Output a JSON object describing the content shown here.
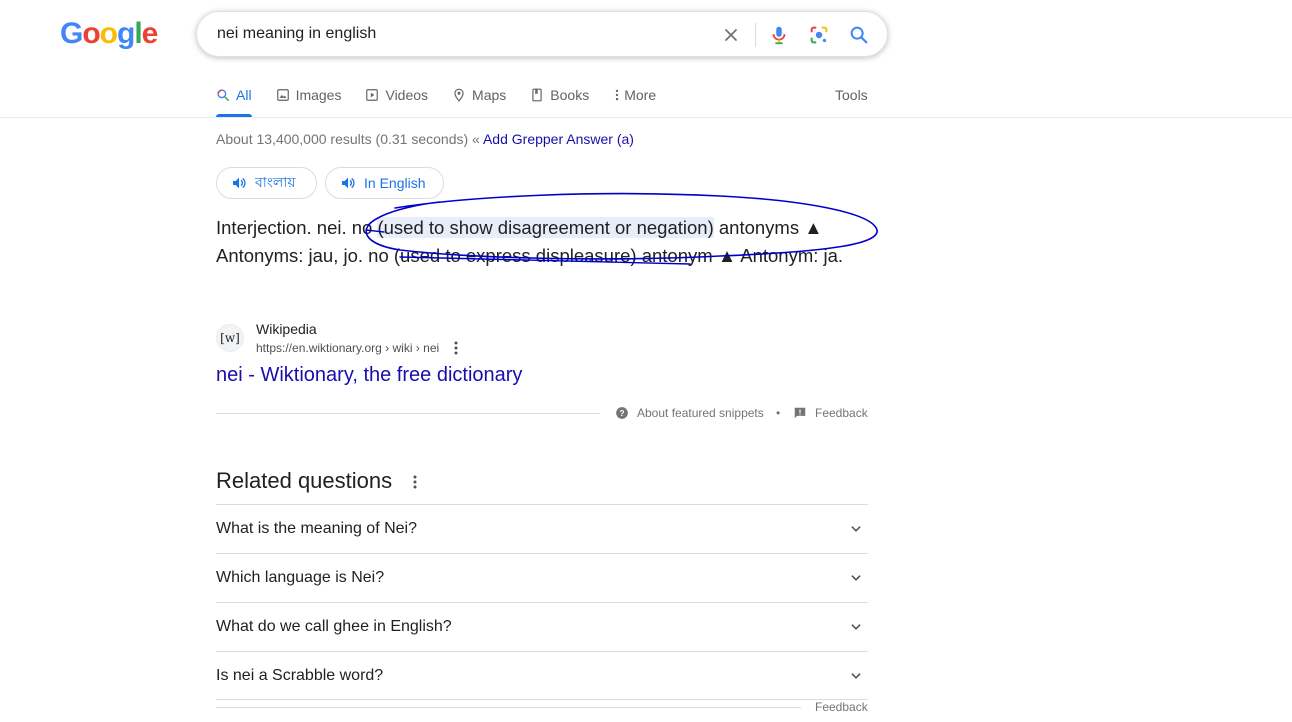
{
  "logo": {
    "letters": [
      "G",
      "o",
      "o",
      "g",
      "l",
      "e"
    ]
  },
  "search": {
    "query": "nei meaning in english"
  },
  "tabs": [
    {
      "label": "All",
      "icon": "search-icon",
      "active": true
    },
    {
      "label": "Images",
      "icon": "image-icon"
    },
    {
      "label": "Videos",
      "icon": "video-icon"
    },
    {
      "label": "Maps",
      "icon": "map-pin-icon"
    },
    {
      "label": "Books",
      "icon": "book-icon"
    },
    {
      "label": "More",
      "icon": "more-vert-icon"
    }
  ],
  "tools_label": "Tools",
  "stats": {
    "text": "About 13,400,000 results (0.31 seconds) « ",
    "link": "Add Grepper Answer (a)"
  },
  "pills": {
    "bangla": "বাংলায়",
    "english": "In English"
  },
  "definition": {
    "part1": "Interjection. nei. ",
    "part2": "no ",
    "highlight": "(used to show disagreement or negation)",
    "part3": " antonyms ▲ Antonyms: jau, jo. no (used to express displeasure) antonym ▲ Antonym: ja."
  },
  "source": {
    "favicon": "[w]",
    "name": "Wikipedia",
    "url": "https://en.wiktionary.org › wiki › nei",
    "title": "nei - Wiktionary, the free dictionary"
  },
  "snippet_footer": {
    "about": "About featured snippets",
    "separator": "•",
    "feedback": "Feedback"
  },
  "related": {
    "title": "Related questions",
    "questions": [
      "What is the meaning of Nei?",
      "Which language is Nei?",
      "What do we call ghee in English?",
      "Is nei a Scrabble word?"
    ],
    "feedback": "Feedback"
  },
  "colors": {
    "link": "#1a0dab",
    "accent": "#1a73e8",
    "annotation": "#0000cc"
  }
}
